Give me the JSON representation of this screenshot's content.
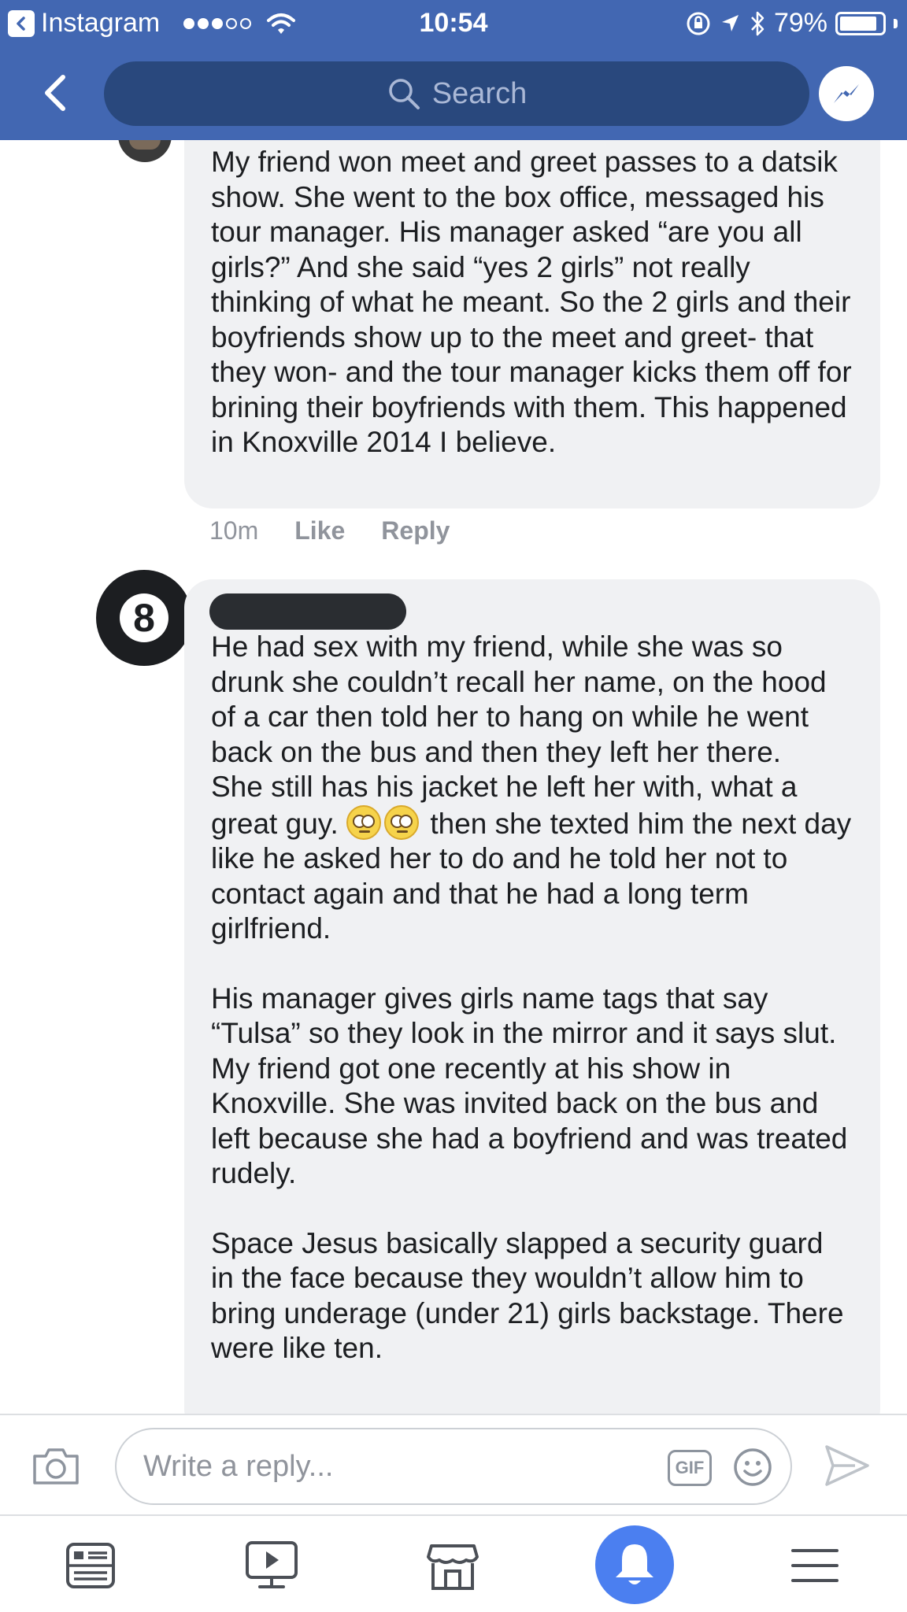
{
  "status_bar": {
    "back_app_label": "Instagram",
    "time": "10:54",
    "battery_text": "79%",
    "battery_level": 0.79
  },
  "nav": {
    "search_placeholder": "Search"
  },
  "comments": [
    {
      "text": "My friend won meet and greet passes to a datsik show. She went to the box office, messaged his tour manager. His manager asked “are you all girls?” And she said “yes 2 girls” not really thinking of what he meant. So the 2 girls and their boyfriends show up to the meet and greet- that they won- and the tour manager kicks them off for brining their boyfriends with them. This happened in Knoxville 2014 I believe.",
      "time": "10m",
      "like_label": "Like",
      "reply_label": "Reply"
    },
    {
      "avatar_text": "8",
      "para1": "He had sex with my friend, while she was so drunk she couldn’t recall her name, on the hood of a car then told her to hang on while he went back on the bus and then they left her there.",
      "para2_before_emoji": "She still has his jacket he left her with, what a great guy. ",
      "para2_after_emoji": " then she texted him the next day like he asked her to do and he told her not to contact again and that he had a long term girlfriend.",
      "para3": "His manager gives girls name tags that say “Tulsa” so they look in the mirror and it says slut. My friend got one recently at his show in Knoxville. She was invited back on the bus and left because she had a boyfriend and was treated rudely.",
      "para4": "Space Jesus basically slapped a security guard in the face because they wouldn’t allow him to bring underage (under 21) girls backstage. There were like ten."
    }
  ],
  "composer": {
    "placeholder": "Write a reply...",
    "gif_label": "GIF"
  },
  "icons": {
    "status": [
      "back-app-icon",
      "wifi-icon",
      "rotation-lock-icon",
      "location-icon",
      "bluetooth-icon",
      "battery-icon"
    ],
    "nav": [
      "back-chevron-icon",
      "search-icon",
      "messenger-icon"
    ],
    "composer": [
      "camera-icon",
      "gif-icon",
      "emoji-icon",
      "send-icon"
    ],
    "tabs": [
      "news-feed-icon",
      "video-icon",
      "marketplace-icon",
      "notifications-icon",
      "menu-icon"
    ]
  },
  "colors": {
    "brand": "#4267b2",
    "search_bg": "#29487d",
    "bubble_bg": "#f0f1f3",
    "meta_text": "#90949c",
    "notification_active": "#4b7ff0"
  }
}
